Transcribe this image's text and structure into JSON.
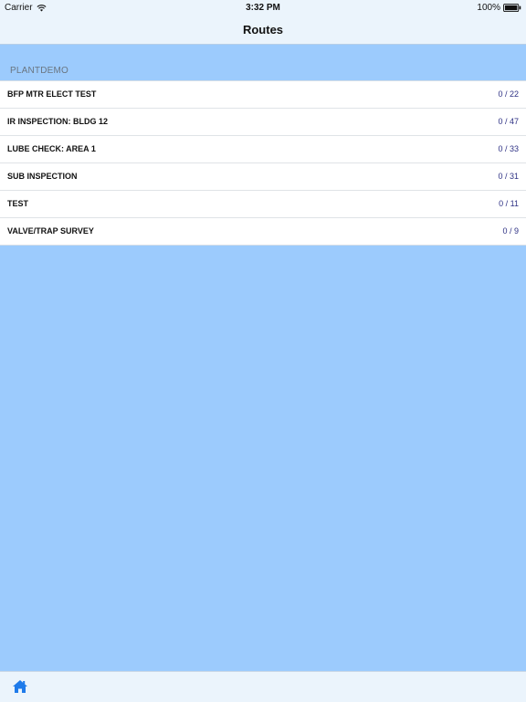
{
  "status_bar": {
    "carrier": "Carrier",
    "time": "3:32 PM",
    "battery": "100%",
    "wifi_icon": "wifi-icon",
    "battery_icon": "battery-icon"
  },
  "nav": {
    "title": "Routes"
  },
  "section": {
    "header": "PLANTDEMO"
  },
  "routes": [
    {
      "name": "BFP MTR ELECT TEST",
      "count": "0 / 22"
    },
    {
      "name": "IR INSPECTION: BLDG 12",
      "count": "0 / 47"
    },
    {
      "name": "LUBE CHECK: AREA 1",
      "count": "0 / 33"
    },
    {
      "name": "SUB INSPECTION",
      "count": "0 / 31"
    },
    {
      "name": "TEST",
      "count": "0 / 11"
    },
    {
      "name": "VALVE/TRAP SURVEY",
      "count": "0 / 9"
    }
  ],
  "tab_bar": {
    "home_icon": "home-icon"
  },
  "colors": {
    "background": "#9ccbfd",
    "bar": "#ebf4fc",
    "count_text": "#2e3184",
    "home_icon": "#1f7bea"
  }
}
